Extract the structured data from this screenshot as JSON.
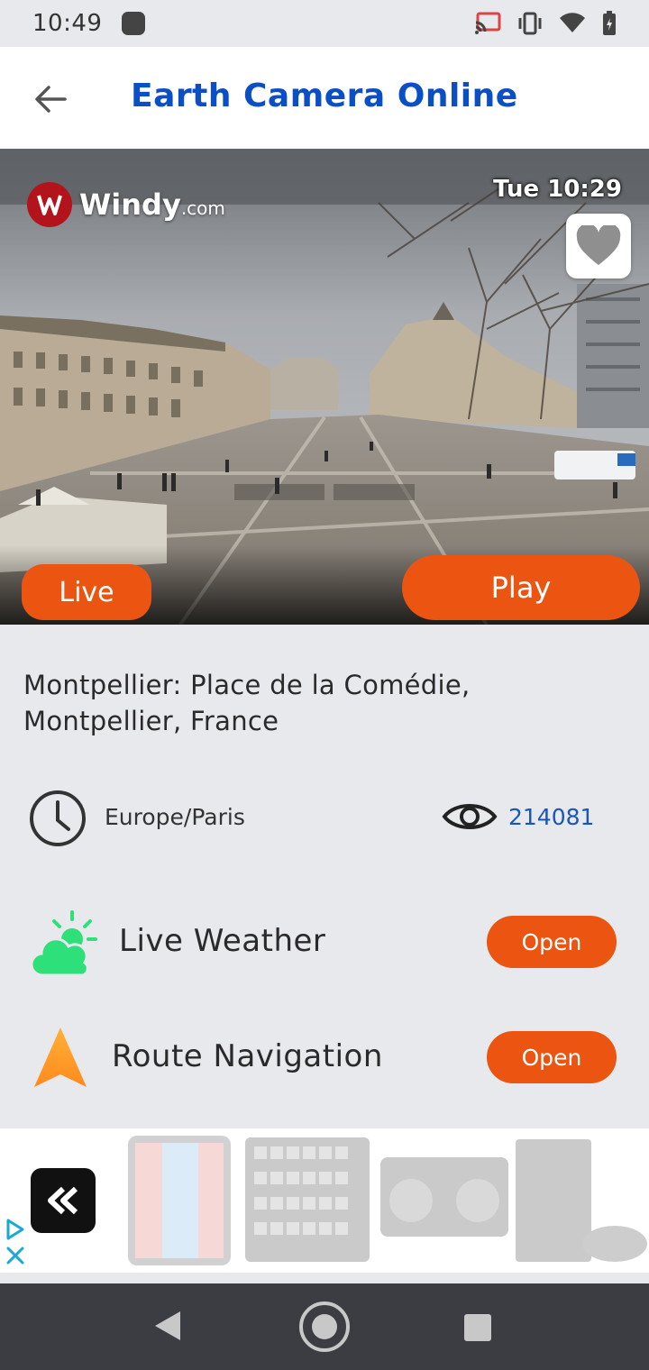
{
  "status_bar": {
    "time": "10:49"
  },
  "app_bar": {
    "title": "Earth Camera Online"
  },
  "camera": {
    "brand": "Windy",
    "brand_suffix": ".com",
    "timestamp": "Tue 10:29",
    "live_label": "Live",
    "play_label": "Play"
  },
  "location": {
    "name": "Montpellier: Place de la Comédie, Montpellier, France",
    "timezone": "Europe/Paris",
    "views": "214081"
  },
  "features": [
    {
      "label": "Live Weather",
      "button": "Open"
    },
    {
      "label": "Route Navigation",
      "button": "Open"
    }
  ],
  "colors": {
    "accent": "#ec5511",
    "title_blue": "#0b4fc4",
    "views_blue": "#1a56b8",
    "background": "#e8e9ed"
  },
  "icons": [
    "back-arrow-icon",
    "heart-icon",
    "clock-icon",
    "eye-icon",
    "weather-icon",
    "navigation-arrow-icon",
    "ad-back-icon",
    "ad-choices-icon",
    "ad-close-icon"
  ]
}
